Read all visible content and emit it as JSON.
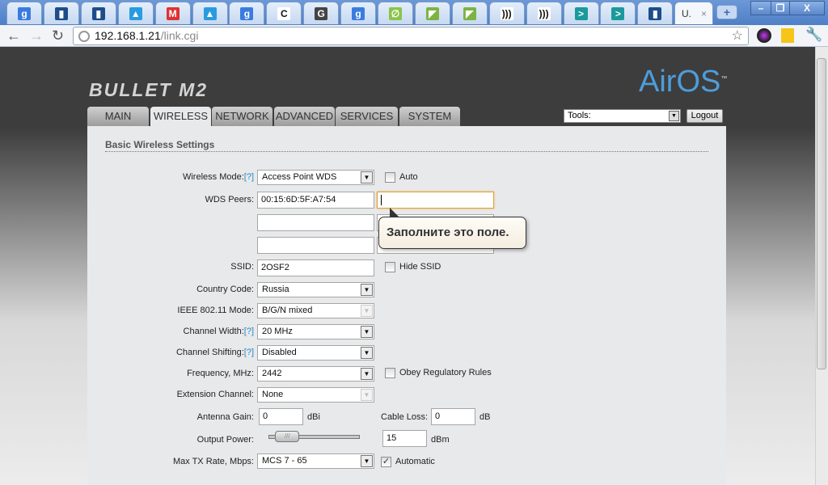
{
  "browser": {
    "tabs": [
      {
        "icon": "google-icon",
        "color": "#3a7be0",
        "glyph": "g"
      },
      {
        "icon": "ubnt-icon",
        "color": "#1d4d8a",
        "glyph": "▮"
      },
      {
        "icon": "ubnt-icon",
        "color": "#1d4d8a",
        "glyph": "▮"
      },
      {
        "icon": "thumb-icon",
        "color": "#2a9be0",
        "glyph": "▲"
      },
      {
        "icon": "gmail-icon",
        "color": "#d33",
        "glyph": "M"
      },
      {
        "icon": "thumb-icon",
        "color": "#2a9be0",
        "glyph": "▲"
      },
      {
        "icon": "google-icon",
        "color": "#3a7be0",
        "glyph": "g"
      },
      {
        "icon": "c-icon",
        "color": "#fff",
        "glyph": "C"
      },
      {
        "icon": "g-icon",
        "color": "#444",
        "glyph": "G"
      },
      {
        "icon": "google-icon",
        "color": "#3a7be0",
        "glyph": "g"
      },
      {
        "icon": "leaf-icon",
        "color": "#8bc34a",
        "glyph": "∅"
      },
      {
        "icon": "arrow-icon",
        "color": "#7cb342",
        "glyph": "◤"
      },
      {
        "icon": "arrow-icon",
        "color": "#7cb342",
        "glyph": "◤"
      },
      {
        "icon": "wifi-icon",
        "color": "#fff",
        "glyph": ")))"
      },
      {
        "icon": "wifi-icon",
        "color": "#fff",
        "glyph": ")))"
      },
      {
        "icon": "chevron-icon",
        "color": "#1a9a9a",
        "glyph": ">"
      },
      {
        "icon": "chevron-icon",
        "color": "#1a9a9a",
        "glyph": ">"
      },
      {
        "icon": "ubnt-icon",
        "color": "#1d4d8a",
        "glyph": "▮"
      }
    ],
    "active_tab": {
      "title": "U.",
      "close": "×"
    },
    "new_tab": "+",
    "window": {
      "minimize": "–",
      "restore": "❐",
      "close": "X"
    },
    "url_host": "192.168.1.21",
    "url_path": "/link.cgi"
  },
  "header": {
    "product": "BULLET M2",
    "brand": "AirOS",
    "tm": "™",
    "tools_label": "Tools:",
    "logout": "Logout"
  },
  "nav": [
    "MAIN",
    "WIRELESS",
    "NETWORK",
    "ADVANCED",
    "SERVICES",
    "SYSTEM"
  ],
  "section_title": "Basic Wireless Settings",
  "form": {
    "wireless_mode": {
      "label": "Wireless Mode:",
      "help": "[?]",
      "value": "Access Point WDS",
      "auto_label": "Auto",
      "auto": false
    },
    "wds": {
      "label": "WDS Peers:",
      "peers": [
        "00:15:6D:5F:A7:54",
        "",
        "",
        "",
        "",
        ""
      ]
    },
    "tooltip": "Заполните это поле.",
    "ssid": {
      "label": "SSID:",
      "value": "2OSF2",
      "hide_label": "Hide SSID",
      "hide": false
    },
    "country": {
      "label": "Country Code:",
      "value": "Russia"
    },
    "ieee": {
      "label": "IEEE 802.11 Mode:",
      "value": "B/G/N mixed"
    },
    "channel_width": {
      "label": "Channel Width:",
      "help": "[?]",
      "value": "20 MHz"
    },
    "channel_shift": {
      "label": "Channel Shifting:",
      "help": "[?]",
      "value": "Disabled"
    },
    "frequency": {
      "label": "Frequency, MHz:",
      "value": "2442",
      "obey_label": "Obey Regulatory Rules",
      "obey": false
    },
    "extension": {
      "label": "Extension Channel:",
      "value": "None"
    },
    "antenna": {
      "label": "Antenna Gain:",
      "value": "0",
      "unit": "dBi"
    },
    "cable": {
      "label": "Cable Loss:",
      "value": "0",
      "unit": "dB"
    },
    "power": {
      "label": "Output Power:",
      "value": "15",
      "unit": "dBm",
      "slider_fraction": 0.1
    },
    "txrate": {
      "label": "Max TX Rate, Mbps:",
      "value": "MCS 7 - 65",
      "auto_label": "Automatic",
      "auto": true
    }
  }
}
